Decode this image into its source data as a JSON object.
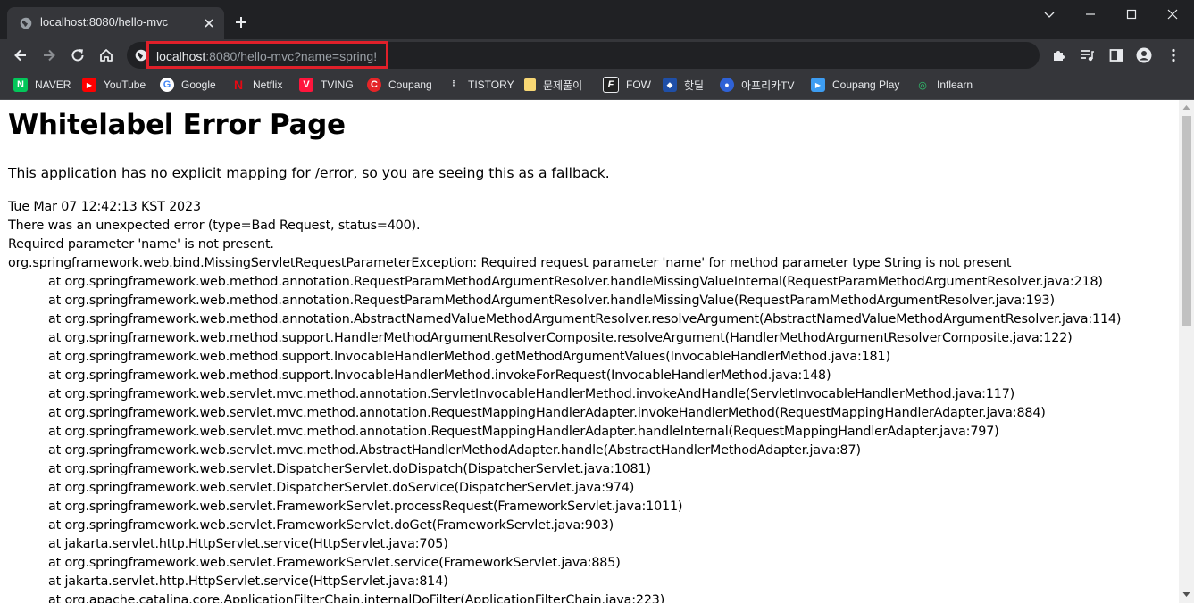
{
  "tab": {
    "title": "localhost:8080/hello-mvc"
  },
  "address_bar": {
    "host": "localhost",
    "rest": ":8080/hello-mvc?name=spring!"
  },
  "bookmarks": [
    {
      "label": "NAVER",
      "icon": "naver-icon",
      "color": "#03c75a",
      "glyph": "N"
    },
    {
      "label": "YouTube",
      "icon": "youtube-icon",
      "color": "#ff0000",
      "glyph": "▶"
    },
    {
      "label": "Google",
      "icon": "google-icon",
      "color": "#ffffff",
      "glyph": "G"
    },
    {
      "label": "Netflix",
      "icon": "netflix-icon",
      "color": "#e50914",
      "glyph": "N"
    },
    {
      "label": "TVING",
      "icon": "tving-icon",
      "color": "#ff153c",
      "glyph": "V"
    },
    {
      "label": "Coupang",
      "icon": "coupang-icon",
      "color": "#e52528",
      "glyph": "C"
    },
    {
      "label": "TISTORY",
      "icon": "tistory-icon",
      "color": "#35363a",
      "glyph": "⁞"
    },
    {
      "label": "문제풀이",
      "icon": "folder-icon",
      "color": "#f7d774",
      "glyph": ""
    },
    {
      "label": "FOW",
      "icon": "fow-icon",
      "color": "#222222",
      "glyph": "F"
    },
    {
      "label": "핫딜",
      "icon": "hotdeal-icon",
      "color": "#1f4fa8",
      "glyph": "◆"
    },
    {
      "label": "아프리카TV",
      "icon": "afreecatv-icon",
      "color": "#2f62d6",
      "glyph": "●"
    },
    {
      "label": "Coupang Play",
      "icon": "coupang-play-icon",
      "color": "#3d9df2",
      "glyph": "▶"
    },
    {
      "label": "Inflearn",
      "icon": "inflearn-icon",
      "color": "#35363a",
      "glyph": "◎"
    }
  ],
  "page": {
    "heading": "Whitelabel Error Page",
    "message": "This application has no explicit mapping for /error, so you are seeing this as a fallback.",
    "timestamp": "Tue Mar 07 12:42:13 KST 2023",
    "error_line": "There was an unexpected error (type=Bad Request, status=400).",
    "detail": "Required parameter 'name' is not present.",
    "exception": "org.springframework.web.bind.MissingServletRequestParameterException: Required request parameter 'name' for method parameter type String is not present",
    "trace": [
      "at org.springframework.web.method.annotation.RequestParamMethodArgumentResolver.handleMissingValueInternal(RequestParamMethodArgumentResolver.java:218)",
      "at org.springframework.web.method.annotation.RequestParamMethodArgumentResolver.handleMissingValue(RequestParamMethodArgumentResolver.java:193)",
      "at org.springframework.web.method.annotation.AbstractNamedValueMethodArgumentResolver.resolveArgument(AbstractNamedValueMethodArgumentResolver.java:114)",
      "at org.springframework.web.method.support.HandlerMethodArgumentResolverComposite.resolveArgument(HandlerMethodArgumentResolverComposite.java:122)",
      "at org.springframework.web.method.support.InvocableHandlerMethod.getMethodArgumentValues(InvocableHandlerMethod.java:181)",
      "at org.springframework.web.method.support.InvocableHandlerMethod.invokeForRequest(InvocableHandlerMethod.java:148)",
      "at org.springframework.web.servlet.mvc.method.annotation.ServletInvocableHandlerMethod.invokeAndHandle(ServletInvocableHandlerMethod.java:117)",
      "at org.springframework.web.servlet.mvc.method.annotation.RequestMappingHandlerAdapter.invokeHandlerMethod(RequestMappingHandlerAdapter.java:884)",
      "at org.springframework.web.servlet.mvc.method.annotation.RequestMappingHandlerAdapter.handleInternal(RequestMappingHandlerAdapter.java:797)",
      "at org.springframework.web.servlet.mvc.method.AbstractHandlerMethodAdapter.handle(AbstractHandlerMethodAdapter.java:87)",
      "at org.springframework.web.servlet.DispatcherServlet.doDispatch(DispatcherServlet.java:1081)",
      "at org.springframework.web.servlet.DispatcherServlet.doService(DispatcherServlet.java:974)",
      "at org.springframework.web.servlet.FrameworkServlet.processRequest(FrameworkServlet.java:1011)",
      "at org.springframework.web.servlet.FrameworkServlet.doGet(FrameworkServlet.java:903)",
      "at jakarta.servlet.http.HttpServlet.service(HttpServlet.java:705)",
      "at org.springframework.web.servlet.FrameworkServlet.service(FrameworkServlet.java:885)",
      "at jakarta.servlet.http.HttpServlet.service(HttpServlet.java:814)",
      "at org.apache.catalina.core.ApplicationFilterChain.internalDoFilter(ApplicationFilterChain.java:223)"
    ]
  },
  "colors": {
    "highlight_box": "#e0202a",
    "chrome_dark": "#202124",
    "chrome_toolbar": "#35363a"
  }
}
